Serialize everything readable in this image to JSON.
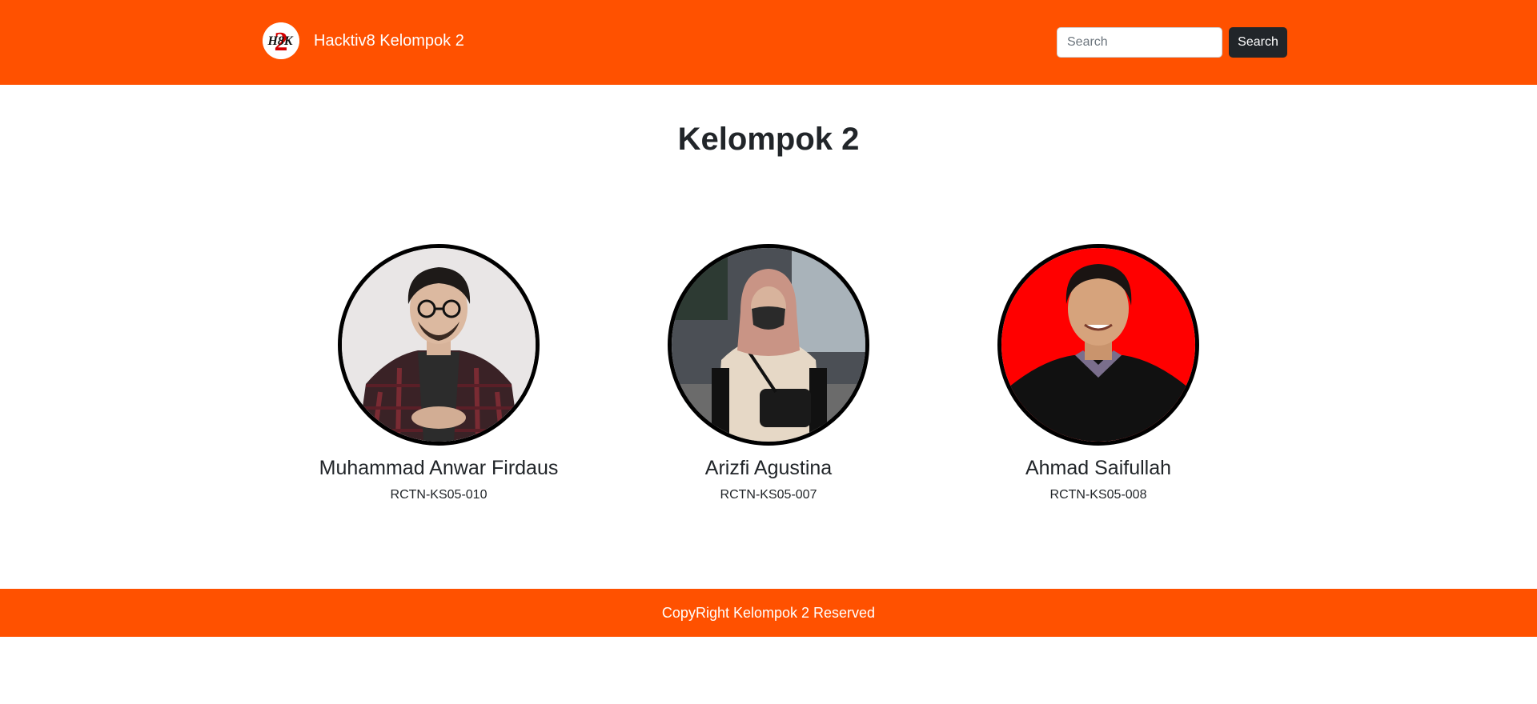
{
  "navbar": {
    "brand_text": "Hacktiv8 Kelompok 2",
    "logo_icon": "h8k2-logo-icon",
    "search_placeholder": "Search",
    "search_button_label": "Search",
    "background_color": "#ff5100"
  },
  "main": {
    "title": "Kelompok 2",
    "members": [
      {
        "name": "Muhammad Anwar Firdaus",
        "id": "RCTN-KS05-010"
      },
      {
        "name": "Arizfi Agustina",
        "id": "RCTN-KS05-007"
      },
      {
        "name": "Ahmad Saifullah",
        "id": "RCTN-KS05-008"
      }
    ]
  },
  "footer": {
    "text": "CopyRight Kelompok 2 Reserved"
  }
}
